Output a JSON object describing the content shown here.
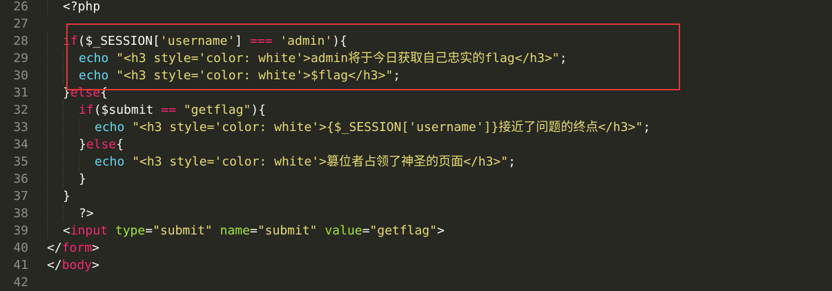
{
  "editor": {
    "lines": [
      {
        "num": "26",
        "indent": 2,
        "tokens": [
          {
            "c": "pl",
            "t": "<?php"
          }
        ]
      },
      {
        "num": "27",
        "indent": 0,
        "tokens": []
      },
      {
        "num": "28",
        "indent": 2,
        "tokens": [
          {
            "c": "kw",
            "t": "if"
          },
          {
            "c": "pl",
            "t": "($_SESSION["
          },
          {
            "c": "st",
            "t": "'username'"
          },
          {
            "c": "pl",
            "t": "] "
          },
          {
            "c": "kw",
            "t": "==="
          },
          {
            "c": "pl",
            "t": " "
          },
          {
            "c": "st",
            "t": "'admin'"
          },
          {
            "c": "pl",
            "t": "){"
          }
        ]
      },
      {
        "num": "29",
        "indent": 4,
        "tokens": [
          {
            "c": "fn",
            "t": "echo"
          },
          {
            "c": "pl",
            "t": " "
          },
          {
            "c": "st",
            "t": "\"<h3 style='color: white'>admin将于今日获取自己忠实的flag</h3>\""
          },
          {
            "c": "pl",
            "t": ";"
          }
        ]
      },
      {
        "num": "30",
        "indent": 4,
        "tokens": [
          {
            "c": "fn",
            "t": "echo"
          },
          {
            "c": "pl",
            "t": " "
          },
          {
            "c": "st",
            "t": "\"<h3 style='color: white'>$flag</h3>\""
          },
          {
            "c": "pl",
            "t": ";"
          }
        ]
      },
      {
        "num": "31",
        "indent": 2,
        "tokens": [
          {
            "c": "pl",
            "t": "}"
          },
          {
            "c": "kw",
            "t": "else"
          },
          {
            "c": "pl",
            "t": "{"
          }
        ]
      },
      {
        "num": "32",
        "indent": 4,
        "tokens": [
          {
            "c": "kw",
            "t": "if"
          },
          {
            "c": "pl",
            "t": "($submit "
          },
          {
            "c": "kw",
            "t": "=="
          },
          {
            "c": "pl",
            "t": " "
          },
          {
            "c": "st",
            "t": "\"getflag\""
          },
          {
            "c": "pl",
            "t": "){"
          }
        ]
      },
      {
        "num": "33",
        "indent": 6,
        "tokens": [
          {
            "c": "fn",
            "t": "echo"
          },
          {
            "c": "pl",
            "t": " "
          },
          {
            "c": "st",
            "t": "\"<h3 style='color: white'>{$_SESSION['username']}接近了问题的终点</h3>\""
          },
          {
            "c": "pl",
            "t": ";"
          }
        ]
      },
      {
        "num": "34",
        "indent": 4,
        "tokens": [
          {
            "c": "pl",
            "t": "}"
          },
          {
            "c": "kw",
            "t": "else"
          },
          {
            "c": "pl",
            "t": "{"
          }
        ]
      },
      {
        "num": "35",
        "indent": 6,
        "tokens": [
          {
            "c": "fn",
            "t": "echo"
          },
          {
            "c": "pl",
            "t": " "
          },
          {
            "c": "st",
            "t": "\"<h3 style='color: white'>篡位者占领了神圣的页面</h3>\""
          },
          {
            "c": "pl",
            "t": ";"
          }
        ]
      },
      {
        "num": "36",
        "indent": 4,
        "tokens": [
          {
            "c": "pl",
            "t": "}"
          }
        ]
      },
      {
        "num": "37",
        "indent": 2,
        "tokens": [
          {
            "c": "pl",
            "t": "}"
          }
        ]
      },
      {
        "num": "38",
        "indent": 4,
        "tokens": [
          {
            "c": "pl",
            "t": "?>"
          }
        ]
      },
      {
        "num": "39",
        "indent": 2,
        "tokens": [
          {
            "c": "pl",
            "t": "<"
          },
          {
            "c": "kw",
            "t": "input"
          },
          {
            "c": "pl",
            "t": " "
          },
          {
            "c": "at",
            "t": "type"
          },
          {
            "c": "pl",
            "t": "="
          },
          {
            "c": "st",
            "t": "\"submit\""
          },
          {
            "c": "pl",
            "t": " "
          },
          {
            "c": "at",
            "t": "name"
          },
          {
            "c": "pl",
            "t": "="
          },
          {
            "c": "st",
            "t": "\"submit\""
          },
          {
            "c": "pl",
            "t": " "
          },
          {
            "c": "at",
            "t": "value"
          },
          {
            "c": "pl",
            "t": "="
          },
          {
            "c": "st",
            "t": "\"getflag\""
          },
          {
            "c": "pl",
            "t": ">"
          }
        ]
      },
      {
        "num": "40",
        "indent": 0,
        "tokens": [
          {
            "c": "pl",
            "t": "</"
          },
          {
            "c": "kw",
            "t": "form"
          },
          {
            "c": "pl",
            "t": ">"
          }
        ]
      },
      {
        "num": "41",
        "indent": 0,
        "tokens": [
          {
            "c": "pl",
            "t": "</"
          },
          {
            "c": "kw",
            "t": "body"
          },
          {
            "c": "pl",
            "t": ">"
          }
        ]
      },
      {
        "num": "42",
        "indent": 0,
        "tokens": []
      }
    ]
  },
  "colors": {
    "background": "#272822",
    "keyword": "#f92672",
    "string": "#e6db74",
    "function": "#66d9ef",
    "attribute": "#a6e22e",
    "line_number": "#8f908a",
    "highlight_border": "#e03a3a"
  }
}
